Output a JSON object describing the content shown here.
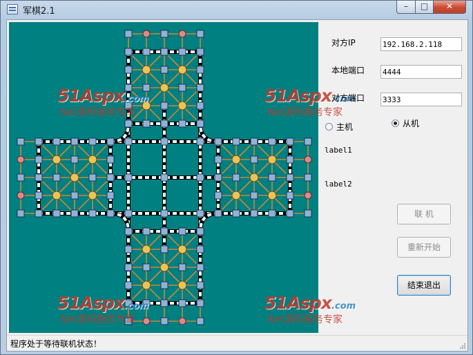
{
  "window": {
    "title": "军棋2.1",
    "controls": {
      "minimize": "–",
      "maximize": "□",
      "close": "✕"
    }
  },
  "board": {
    "background": "#008080",
    "rail_color": "#ffffff",
    "road_color": "#c8893a",
    "post_color": "#8fb3d6",
    "camp_color": "#e8c45a",
    "hq_color": "#d98c8c"
  },
  "watermarks": [
    {
      "main": "51Aspx",
      "suffix": ".com",
      "sub": ".Net源码服务专家"
    },
    {
      "main": "51Aspx",
      "suffix": ".com",
      "sub": ".Net源码服务专家"
    },
    {
      "main": "51Aspx",
      "suffix": ".com",
      "sub": ".Net源码服务专家"
    },
    {
      "main": "51Aspx",
      "suffix": ".com",
      "sub": ".Net源码服务专家"
    }
  ],
  "form": {
    "peer_ip_label": "对方IP",
    "peer_ip_value": "192.168.2.118",
    "local_port_label": "本地端口",
    "local_port_value": "4444",
    "peer_port_label": "对方端口",
    "peer_port_value": "3333",
    "host_radio_label": "主机",
    "client_radio_label": "从机",
    "label1": "label1",
    "label2": "label2",
    "connect_button": "联  机",
    "restart_button": "重新开始",
    "exit_button": "结束退出"
  },
  "status": {
    "text": "程序处于等待联机状态！"
  }
}
